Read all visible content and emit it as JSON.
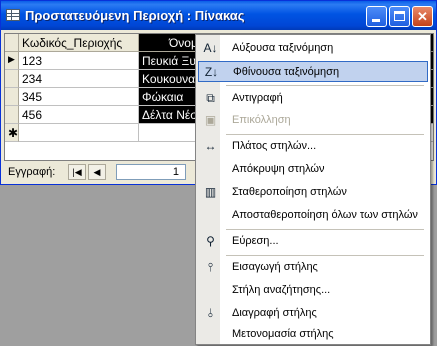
{
  "window": {
    "title": "Προστατευόμενη Περιοχή : Πίνακας",
    "controls": {
      "minimize": "",
      "maximize": "",
      "close": "✕"
    }
  },
  "grid": {
    "headers": [
      "Κωδικός_Περιοχής",
      "Όνομα"
    ],
    "rows": [
      {
        "code": "123",
        "name": "Πευκιά Ξυ"
      },
      {
        "code": "234",
        "name": "Κουκουνα"
      },
      {
        "code": "345",
        "name": "Φώκαια"
      },
      {
        "code": "456",
        "name": "Δέλτα Νέσ"
      }
    ],
    "current_row_marker": "▶",
    "new_row_marker": "✱"
  },
  "navigation": {
    "label": "Εγγραφή:",
    "first": "|◀",
    "prev": "◀",
    "record": "1"
  },
  "context_menu": {
    "items": [
      {
        "label": "Αύξουσα ταξινόμηση",
        "icon": "sort-ascending-icon",
        "glyph": "A↓"
      },
      {
        "label": "Φθίνουσα ταξινόμηση",
        "icon": "sort-descending-icon",
        "glyph": "Z↓",
        "highlighted": true
      },
      {
        "label": "Αντιγραφή",
        "icon": "copy-icon",
        "glyph": "⧉"
      },
      {
        "label": "Επικόλληση",
        "icon": "paste-icon",
        "glyph": "📋",
        "disabled": true
      },
      {
        "label": "Πλάτος στηλών...",
        "icon": "column-width-icon",
        "glyph": "↔"
      },
      {
        "label": "Απόκρυψη στηλών",
        "icon": "",
        "glyph": ""
      },
      {
        "label": "Σταθεροποίηση στηλών",
        "icon": "freeze-columns-icon",
        "glyph": "▥"
      },
      {
        "label": "Αποσταθεροποίηση όλων των στηλών",
        "icon": "",
        "glyph": ""
      },
      {
        "label": "Εύρεση...",
        "icon": "binoculars-icon",
        "glyph": "🔭"
      },
      {
        "label": "Εισαγωγή στήλης",
        "icon": "insert-column-icon",
        "glyph": "⫯"
      },
      {
        "label": "Στήλη αναζήτησης...",
        "icon": "",
        "glyph": ""
      },
      {
        "label": "Διαγραφή στήλης",
        "icon": "delete-column-icon",
        "glyph": "⫰"
      },
      {
        "label": "Μετονομασία στήλης",
        "icon": "",
        "glyph": ""
      }
    ]
  }
}
